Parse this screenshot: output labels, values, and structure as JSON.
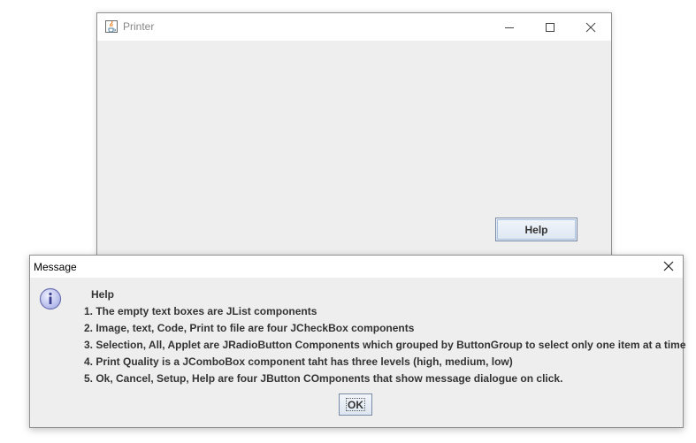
{
  "printer_window": {
    "title": "Printer",
    "icon": "java-cup-icon",
    "help_button_label": "Help"
  },
  "message_dialog": {
    "title": "Message",
    "icon": "info-icon",
    "lines": [
      "Help",
      "1. The empty text boxes are JList components",
      "2. Image, text, Code, Print to file are four JCheckBox components",
      "3. Selection, All, Applet are JRadioButton Components which grouped by ButtonGroup to select only one item at a time",
      "4. Print Quality is a JComboBox component taht has three levels (high, medium, low)",
      "5. Ok, Cancel, Setup, Help are four JButton COmponents that show message dialogue on click."
    ],
    "ok_button_label": "OK"
  },
  "colors": {
    "window_bg": "#eeeeee",
    "titlebar_bg": "#ffffff",
    "button_border": "#7a8aa5",
    "info_icon_fill": "#c8cdf0"
  }
}
